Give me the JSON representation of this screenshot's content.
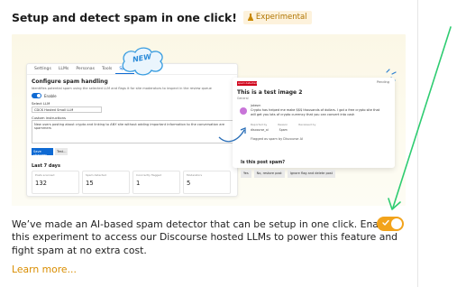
{
  "header": {
    "title": "Setup and detect spam in one click!",
    "badge_label": "Experimental"
  },
  "promo_image": {
    "new_label": "NEW",
    "tabs": [
      "Settings",
      "LLMs",
      "Personas",
      "Tools",
      "Spam"
    ],
    "active_tab": "Spam",
    "panel_title": "Configure spam handling",
    "panel_description": "Identifies potential spam using the selected LLM and flags it for site moderators to inspect in the review queue",
    "enable_label": "Enable",
    "select_llm_label": "Select LLM",
    "select_llm_value": "CDCK Hosted Small LLM",
    "custom_instructions_label": "Custom instructions",
    "custom_instructions_value": "New users posting about crypto and linking to ANY site without adding important information to the conversation are spammers",
    "save_button": "Save changes",
    "test_button": "Test...",
    "last7_title": "Last 7 days",
    "stats": [
      {
        "label": "Posts scanned",
        "value": "132"
      },
      {
        "label": "Spam detected",
        "value": "15"
      },
      {
        "label": "Incorrectly flagged",
        "value": "1"
      },
      {
        "label": "Moderators",
        "value": "5"
      }
    ],
    "card": {
      "red_label": "spam detected",
      "status": "Pending",
      "title": "This is a test image 2",
      "category": "General",
      "username": "jakesm",
      "body": "Crypto has helped me make $$$ thousands of dollars. I got a free crypto site that will get you lots of crypto currency that you can convert into cash",
      "columns": [
        "Reported by",
        "Reason",
        "Reviewed by"
      ],
      "row": [
        "discourse_ai",
        "Spam",
        ""
      ],
      "flagged_by": "Flagged as spam by Discourse AI"
    },
    "question": "Is this post spam?",
    "actions": [
      "Yes",
      "No, restore post",
      "Ignore flag and delete post"
    ]
  },
  "description": "We’ve made an AI-based spam detector that can be setup in one click. Enable this experiment to access our Discourse hosted LLMs to power this feature and fight spam at no extra cost.",
  "learn_more": "Learn more...",
  "toggle_enabled": true,
  "colors": {
    "accent": "#f2a31b",
    "link": "#d98d00",
    "badge_bg": "#fdf2dc",
    "badge_text": "#b07400",
    "arrow": "#2ecc71"
  },
  "icons": [
    "flask-icon",
    "check-icon",
    "sparkle-icon",
    "curved-arrow-icon"
  ]
}
